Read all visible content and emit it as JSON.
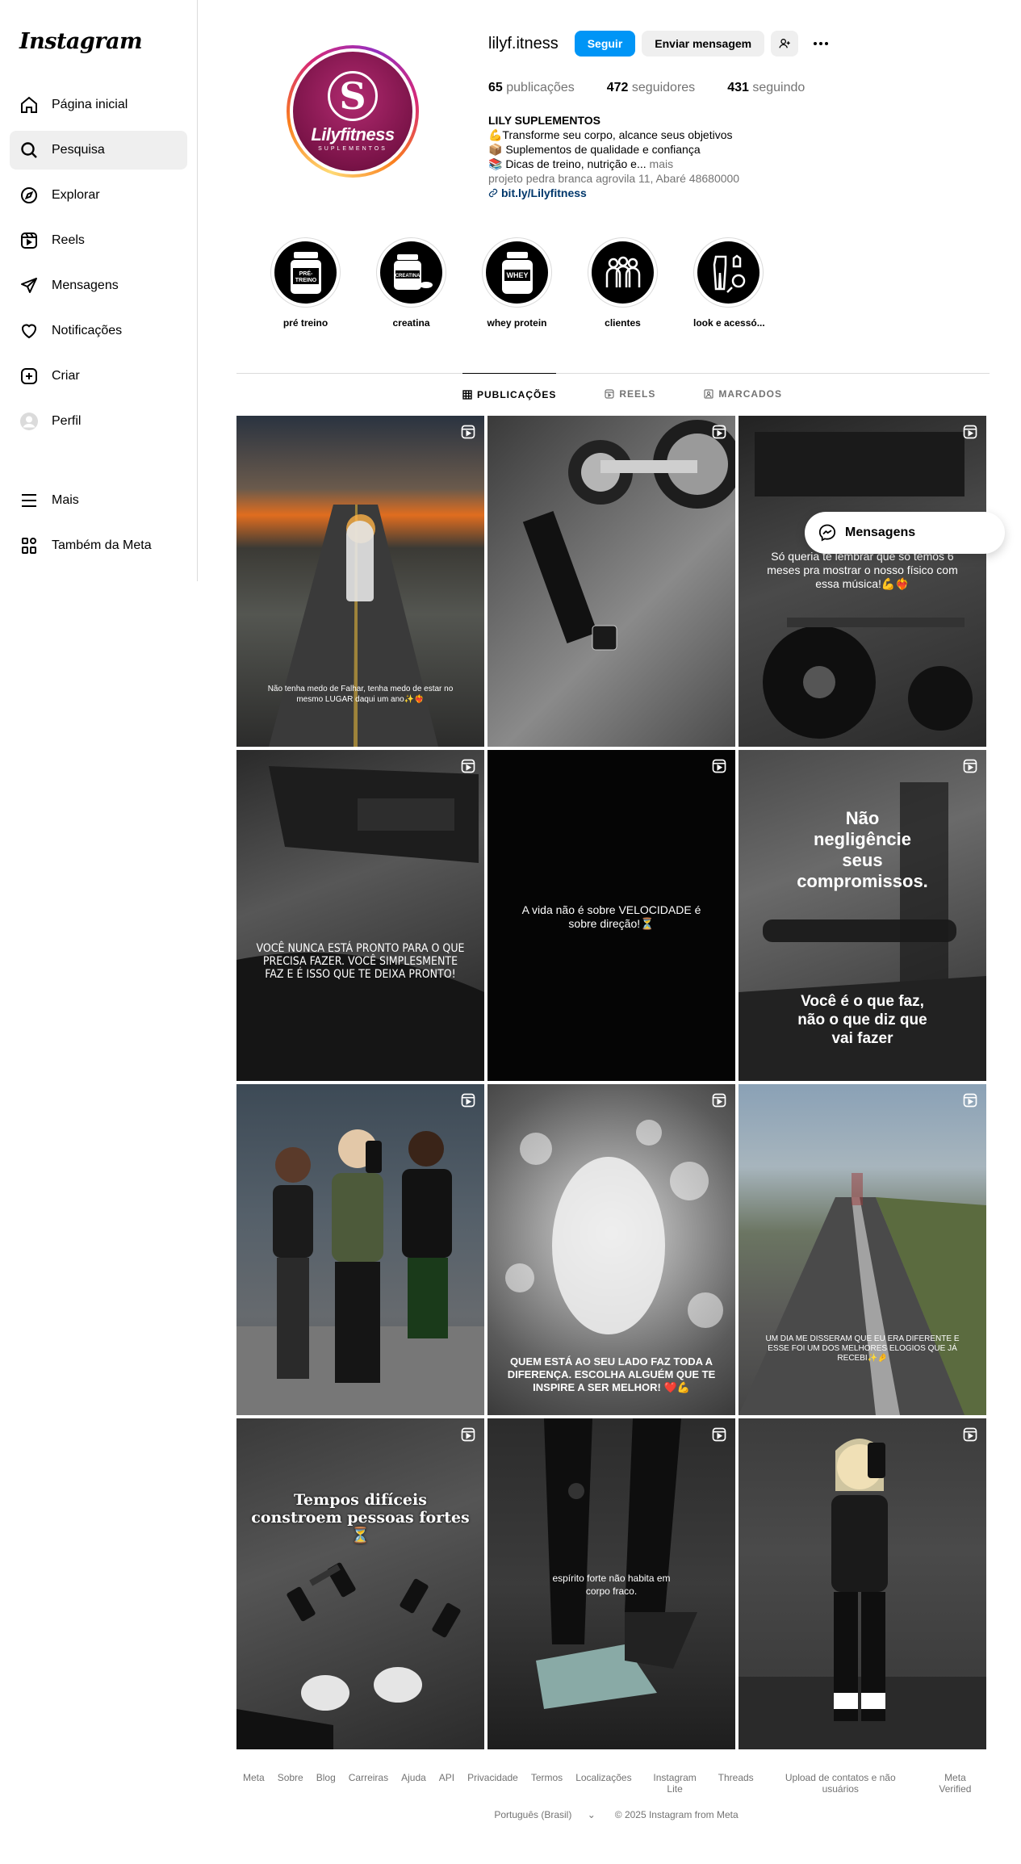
{
  "app": {
    "logo": "Instagram"
  },
  "sidebar": {
    "items": [
      {
        "label": "Página inicial",
        "icon": "home-icon"
      },
      {
        "label": "Pesquisa",
        "icon": "search-icon"
      },
      {
        "label": "Explorar",
        "icon": "compass-icon"
      },
      {
        "label": "Reels",
        "icon": "reels-icon"
      },
      {
        "label": "Mensagens",
        "icon": "send-icon"
      },
      {
        "label": "Notificações",
        "icon": "heart-icon"
      },
      {
        "label": "Criar",
        "icon": "plus-square-icon"
      },
      {
        "label": "Perfil",
        "icon": "avatar-icon"
      }
    ],
    "bottom": [
      {
        "label": "Mais",
        "icon": "menu-icon"
      },
      {
        "label": "Também da Meta",
        "icon": "meta-apps-icon"
      }
    ],
    "active_index": 1
  },
  "profile": {
    "username": "lilyf.itness",
    "follow_label": "Seguir",
    "message_label": "Enviar mensagem",
    "stats": {
      "posts_count": "65",
      "posts_label": "publicações",
      "followers_count": "472",
      "followers_label": "seguidores",
      "following_count": "431",
      "following_label": "seguindo"
    },
    "avatar": {
      "brand": "Lilyfitness",
      "sub": "SUPLEMENTOS",
      "monogram": "S"
    },
    "bio": {
      "name": "LILY SUPLEMENTOS",
      "line1": "💪Transforme seu corpo, alcance seus objetivos",
      "line2": "📦 Suplementos de qualidade e confiança",
      "line3": "📚 Dicas de treino, nutrição e...",
      "more": "mais",
      "address": "projeto pedra branca agrovila 11, Abaré 48680000",
      "link": "bit.ly/Lilyfitness"
    }
  },
  "highlights": [
    {
      "label": "pré treino",
      "art": "PRÉ-TREINO"
    },
    {
      "label": "creatina",
      "art": "CREATINA"
    },
    {
      "label": "whey protein",
      "art": "WHEY"
    },
    {
      "label": "clientes",
      "art": ""
    },
    {
      "label": "look e acessó...",
      "art": ""
    }
  ],
  "tabs": [
    {
      "label": "PUBLICAÇÕES",
      "icon": "grid-icon"
    },
    {
      "label": "REELS",
      "icon": "reels-icon"
    },
    {
      "label": "MARCADOS",
      "icon": "tag-icon"
    }
  ],
  "posts": {
    "p1": "Não tenha medo de Falhar, tenha medo de estar no mesmo LUGAR daqui um ano✨❤️‍🔥",
    "p3": "Só queria te lembrar que só temos 6 meses pra mostrar o nosso físico com essa música!💪❤️‍🔥",
    "p4": "VOCÊ NUNCA ESTÁ PRONTO PARA O QUE PRECISA FAZER. VOCÊ SIMPLESMENTE FAZ E É ISSO QUE TE DEIXA PRONTO!",
    "p5": "A vida não é sobre VELOCIDADE é sobre direção!⏳",
    "p6a": "Não negligêncie seus compromissos.",
    "p6b": "Você é o que faz, não o que diz que vai fazer",
    "p8": "QUEM ESTÁ AO SEU LADO FAZ TODA A DIFERENÇA. ESCOLHA ALGUÉM QUE TE INSPIRE A SER MELHOR! ❤️💪",
    "p9": "UM DIA ME DISSERAM QUE EU ERA DIFERENTE E ESSE FOI UM DOS MELHORES ELOGIOS QUE JÁ RECEBI✨🤌",
    "p10": "Tempos difíceis constroem pessoas fortes⏳",
    "p11": "espírito forte não habita em corpo fraco."
  },
  "floating": {
    "messages_label": "Mensagens"
  },
  "footer": {
    "links": [
      "Meta",
      "Sobre",
      "Blog",
      "Carreiras",
      "Ajuda",
      "API",
      "Privacidade",
      "Termos",
      "Localizações",
      "Instagram Lite",
      "Threads",
      "Upload de contatos e não usuários",
      "Meta Verified"
    ],
    "language": "Português (Brasil)",
    "copyright": "© 2025 Instagram from Meta"
  }
}
